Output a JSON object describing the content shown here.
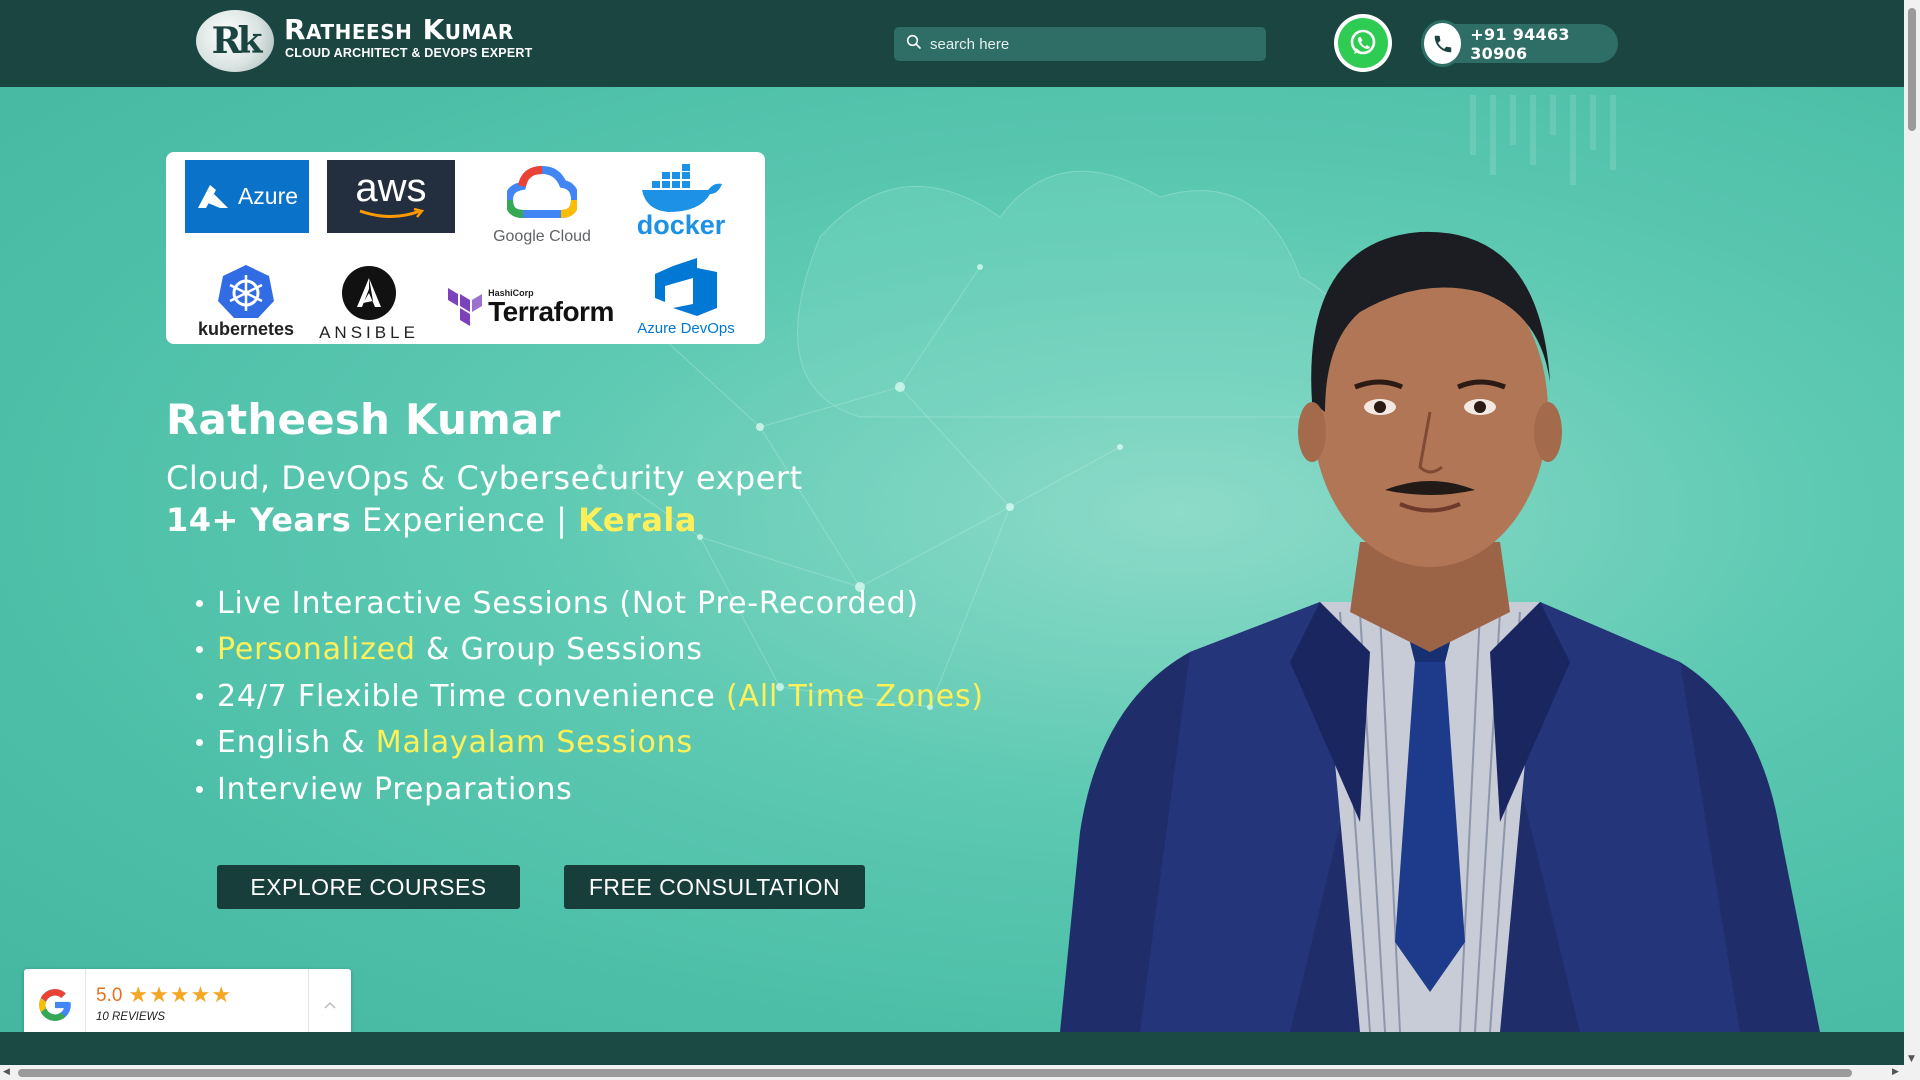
{
  "header": {
    "brand_name": "Ratheesh Kumar",
    "brand_tagline": "CLOUD ARCHITECT & DEVOPS EXPERT",
    "logo_monogram": "Rk",
    "search_placeholder": "search here",
    "phone": "+91 94463 30906",
    "icons": {
      "search": "search-icon",
      "whatsapp": "whatsapp-icon",
      "phone": "phone-icon"
    }
  },
  "tech_logos": [
    {
      "label": "Azure",
      "icon": "azure-logo"
    },
    {
      "label": "aws",
      "icon": "aws-logo"
    },
    {
      "label": "Google Cloud",
      "icon": "google-cloud-logo"
    },
    {
      "label": "docker",
      "icon": "docker-logo"
    },
    {
      "label": "kubernetes",
      "icon": "kubernetes-logo"
    },
    {
      "label": "ANSIBLE",
      "icon": "ansible-logo"
    },
    {
      "label": "HashiCorp",
      "icon": "terraform-logo"
    },
    {
      "label": "Terraform",
      "icon": "terraform-logo"
    },
    {
      "label": "Azure DevOps",
      "icon": "azure-devops-logo"
    }
  ],
  "hero": {
    "name": "Ratheesh Kumar",
    "subtitle": "Cloud, DevOps & Cybersecurity expert",
    "experience": {
      "years": "14+ Years",
      "label": " Experience | ",
      "location": "Kerala"
    },
    "bullets": [
      {
        "parts": [
          {
            "text": "Live Interactive Sessions (Not Pre-Recorded)",
            "highlight": false
          }
        ]
      },
      {
        "parts": [
          {
            "text": "Personalized",
            "highlight": true
          },
          {
            "text": " & Group Sessions",
            "highlight": false
          }
        ]
      },
      {
        "parts": [
          {
            "text": "24/7 Flexible Time convenience ",
            "highlight": false
          },
          {
            "text": "(All Time Zones)",
            "highlight": true
          }
        ]
      },
      {
        "parts": [
          {
            "text": "English & ",
            "highlight": false
          },
          {
            "text": "Malayalam Sessions",
            "highlight": true
          }
        ]
      },
      {
        "parts": [
          {
            "text": "Interview Preparations",
            "highlight": false
          }
        ]
      }
    ],
    "buttons": {
      "explore": "EXPLORE COURSES",
      "consult": "FREE CONSULTATION"
    }
  },
  "reviews_widget": {
    "score": "5.0",
    "rating": 5,
    "max_rating": 5,
    "stars": "★★★★★",
    "count_label": "10 REVIEWS",
    "icon": "google-icon"
  },
  "colors": {
    "header_bg": "#1a4540",
    "hero_teal": "#4dbfa8",
    "button_bg": "#173e3a",
    "highlight_yellow": "#fef05a",
    "whatsapp_green": "#2ecc52",
    "star_orange": "#f5a623"
  }
}
